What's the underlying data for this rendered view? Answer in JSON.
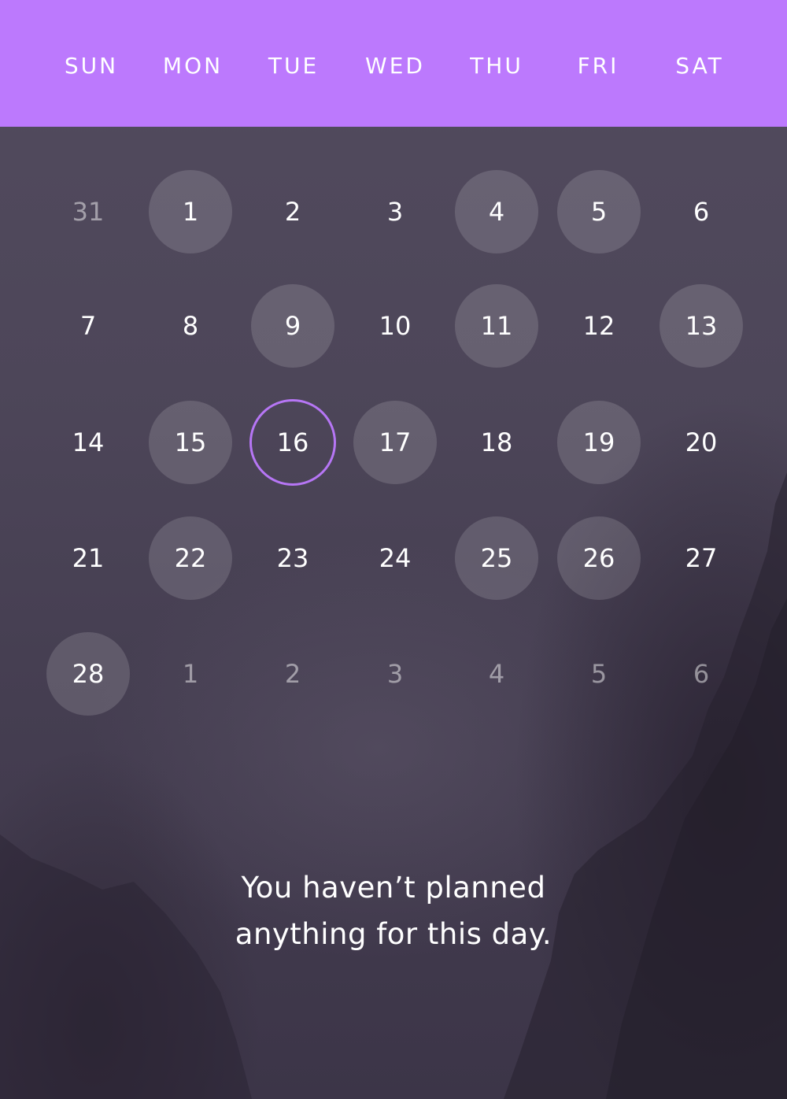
{
  "header": {
    "weekdays": [
      "SUN",
      "MON",
      "TUE",
      "WED",
      "THU",
      "FRI",
      "SAT"
    ],
    "background_color": "#bc79fd"
  },
  "calendar": {
    "selected_color": "#b676f5",
    "weeks": [
      [
        {
          "label": "31",
          "in_month": false,
          "has_plan": false,
          "selected": false
        },
        {
          "label": "1",
          "in_month": true,
          "has_plan": true,
          "selected": false
        },
        {
          "label": "2",
          "in_month": true,
          "has_plan": false,
          "selected": false
        },
        {
          "label": "3",
          "in_month": true,
          "has_plan": false,
          "selected": false
        },
        {
          "label": "4",
          "in_month": true,
          "has_plan": true,
          "selected": false
        },
        {
          "label": "5",
          "in_month": true,
          "has_plan": true,
          "selected": false
        },
        {
          "label": "6",
          "in_month": true,
          "has_plan": false,
          "selected": false
        }
      ],
      [
        {
          "label": "7",
          "in_month": true,
          "has_plan": false,
          "selected": false
        },
        {
          "label": "8",
          "in_month": true,
          "has_plan": false,
          "selected": false
        },
        {
          "label": "9",
          "in_month": true,
          "has_plan": true,
          "selected": false
        },
        {
          "label": "10",
          "in_month": true,
          "has_plan": false,
          "selected": false
        },
        {
          "label": "11",
          "in_month": true,
          "has_plan": true,
          "selected": false
        },
        {
          "label": "12",
          "in_month": true,
          "has_plan": false,
          "selected": false
        },
        {
          "label": "13",
          "in_month": true,
          "has_plan": true,
          "selected": false
        }
      ],
      [
        {
          "label": "14",
          "in_month": true,
          "has_plan": false,
          "selected": false
        },
        {
          "label": "15",
          "in_month": true,
          "has_plan": true,
          "selected": false
        },
        {
          "label": "16",
          "in_month": true,
          "has_plan": false,
          "selected": true
        },
        {
          "label": "17",
          "in_month": true,
          "has_plan": true,
          "selected": false
        },
        {
          "label": "18",
          "in_month": true,
          "has_plan": false,
          "selected": false
        },
        {
          "label": "19",
          "in_month": true,
          "has_plan": true,
          "selected": false
        },
        {
          "label": "20",
          "in_month": true,
          "has_plan": false,
          "selected": false
        }
      ],
      [
        {
          "label": "21",
          "in_month": true,
          "has_plan": false,
          "selected": false
        },
        {
          "label": "22",
          "in_month": true,
          "has_plan": true,
          "selected": false
        },
        {
          "label": "23",
          "in_month": true,
          "has_plan": false,
          "selected": false
        },
        {
          "label": "24",
          "in_month": true,
          "has_plan": false,
          "selected": false
        },
        {
          "label": "25",
          "in_month": true,
          "has_plan": true,
          "selected": false
        },
        {
          "label": "26",
          "in_month": true,
          "has_plan": true,
          "selected": false
        },
        {
          "label": "27",
          "in_month": true,
          "has_plan": false,
          "selected": false
        }
      ],
      [
        {
          "label": "28",
          "in_month": true,
          "has_plan": true,
          "selected": false
        },
        {
          "label": "1",
          "in_month": false,
          "has_plan": false,
          "selected": false
        },
        {
          "label": "2",
          "in_month": false,
          "has_plan": false,
          "selected": false
        },
        {
          "label": "3",
          "in_month": false,
          "has_plan": false,
          "selected": false
        },
        {
          "label": "4",
          "in_month": false,
          "has_plan": false,
          "selected": false
        },
        {
          "label": "5",
          "in_month": false,
          "has_plan": false,
          "selected": false
        },
        {
          "label": "6",
          "in_month": false,
          "has_plan": false,
          "selected": false
        }
      ]
    ]
  },
  "empty_state": {
    "line1": "You haven’t planned",
    "line2": "anything for this day."
  }
}
